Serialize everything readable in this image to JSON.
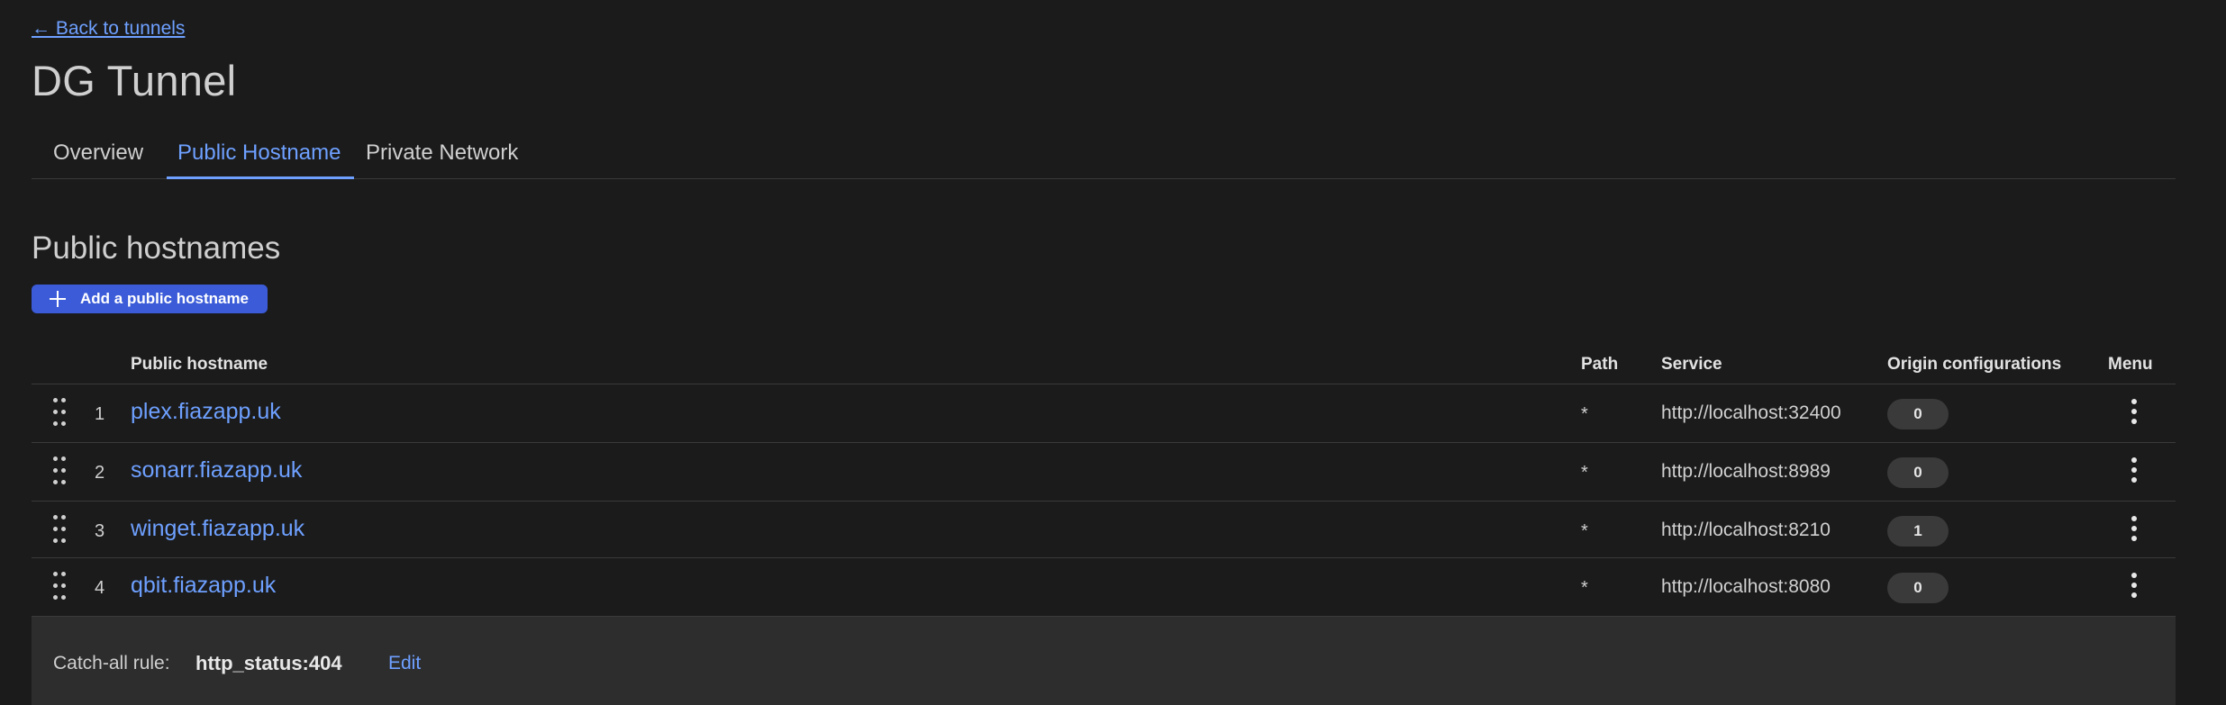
{
  "back_link": "← Back to tunnels",
  "title": "DG Tunnel",
  "tabs": [
    {
      "label": "Overview",
      "active": false
    },
    {
      "label": "Public Hostname",
      "active": true
    },
    {
      "label": "Private Network",
      "active": false
    }
  ],
  "section_title": "Public hostnames",
  "add_button": {
    "label": "Add a public hostname",
    "icon": "plus-icon"
  },
  "table": {
    "columns": {
      "hostname": "Public hostname",
      "path": "Path",
      "service": "Service",
      "origin": "Origin configurations",
      "menu": "Menu"
    },
    "rows": [
      {
        "num": "1",
        "hostname": "plex.fiazapp.uk",
        "path": "*",
        "service": "http://localhost:32400",
        "origin": "0"
      },
      {
        "num": "2",
        "hostname": "sonarr.fiazapp.uk",
        "path": "*",
        "service": "http://localhost:8989",
        "origin": "0"
      },
      {
        "num": "3",
        "hostname": "winget.fiazapp.uk",
        "path": "*",
        "service": "http://localhost:8210",
        "origin": "1"
      },
      {
        "num": "4",
        "hostname": "qbit.fiazapp.uk",
        "path": "*",
        "service": "http://localhost:8080",
        "origin": "0"
      }
    ]
  },
  "catch_all": {
    "label": "Catch-all rule:",
    "value": "http_status:404",
    "edit_label": "Edit"
  },
  "colors": {
    "accent": "#6ea0ff",
    "button": "#3b5bd8",
    "background": "#1b1b1b"
  }
}
